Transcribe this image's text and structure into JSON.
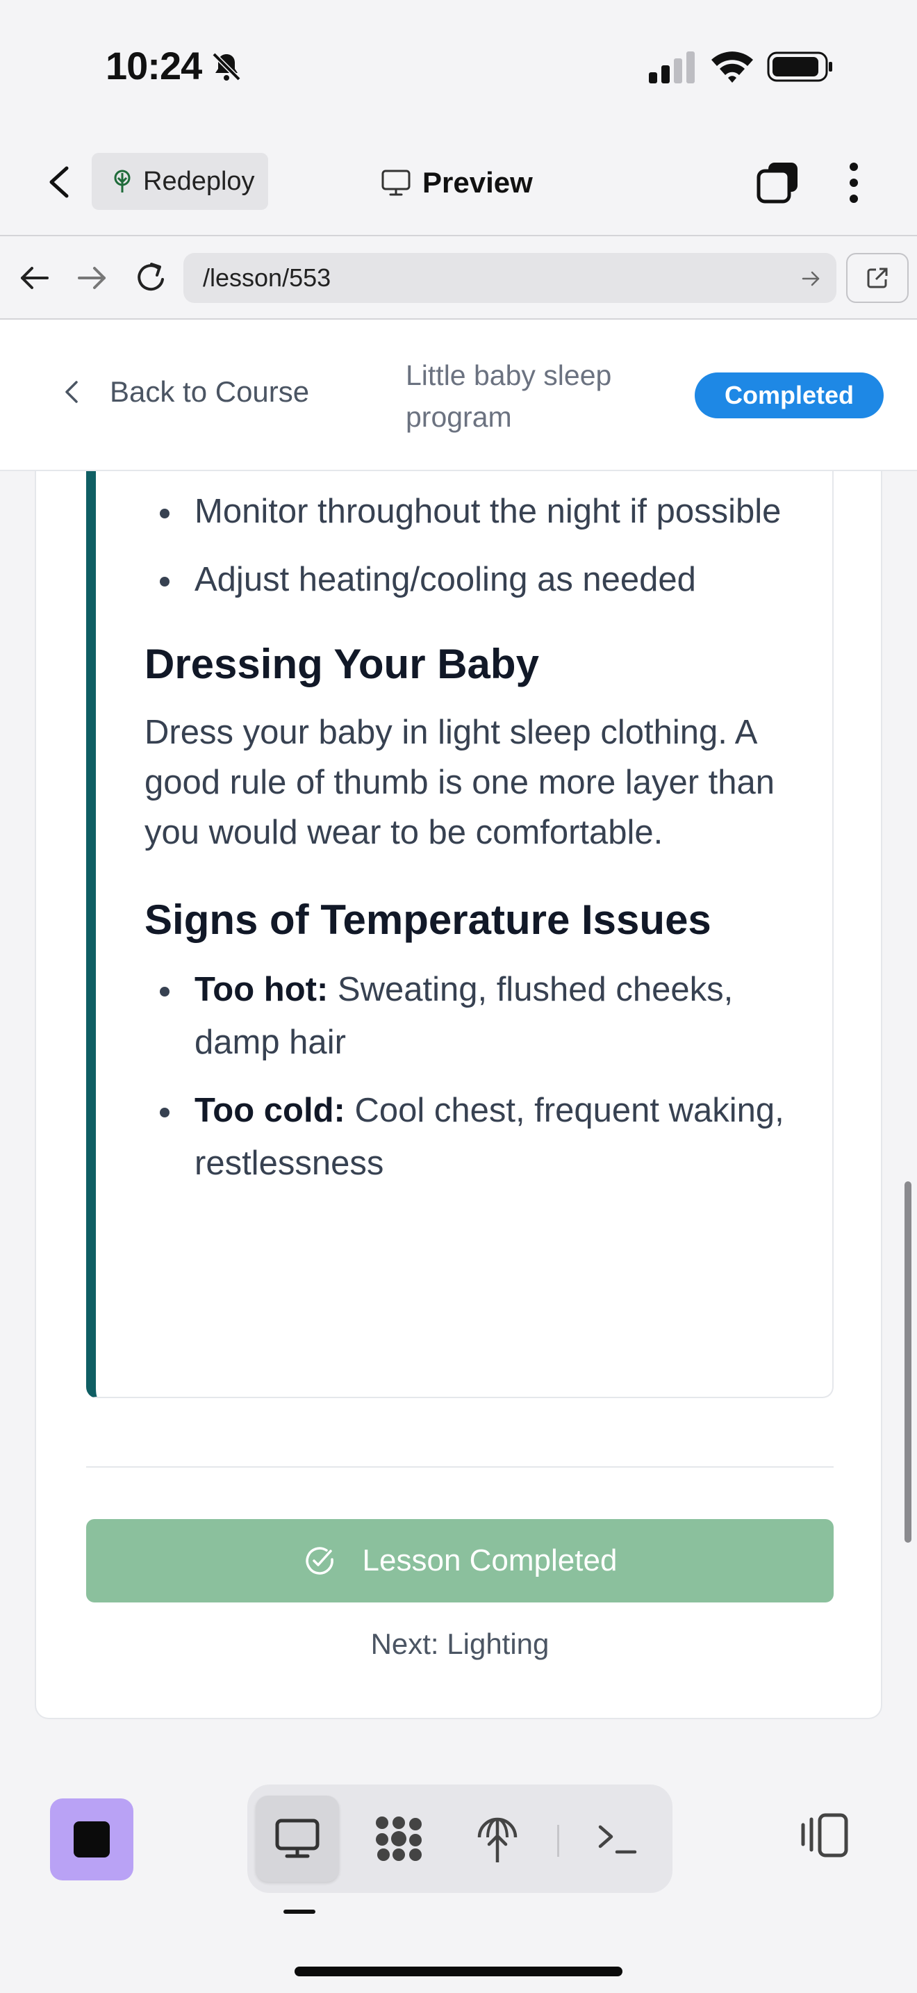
{
  "status_bar": {
    "time": "10:24"
  },
  "app_bar": {
    "redeploy_label": "Redeploy",
    "preview_label": "Preview"
  },
  "browser": {
    "url": "/lesson/553"
  },
  "page_header": {
    "back_label": "Back to Course",
    "course_title": "Little baby sleep program",
    "status_badge": "Completed"
  },
  "lesson": {
    "top_bullets": [
      "Monitor throughout the night if possible",
      "Adjust heating/cooling as needed"
    ],
    "dressing": {
      "heading": "Dressing Your Baby",
      "text": "Dress your baby in light sleep clothing. A good rule of thumb is one more layer than you would wear to be comfortable."
    },
    "signs": {
      "heading": "Signs of Temperature Issues",
      "items": [
        {
          "label": "Too hot:",
          "text": " Sweating, flushed cheeks, damp hair"
        },
        {
          "label": "Too cold:",
          "text": " Cool chest, frequent waking, restlessness"
        }
      ]
    }
  },
  "footer": {
    "completed_button": "Lesson Completed",
    "next_lesson": "Next: Lighting"
  },
  "colors": {
    "accent_border": "#0f5e63",
    "badge_blue": "#1e88e5",
    "completed_green": "#8bc09d",
    "stop_purple": "#b9a2f5"
  },
  "icons": {
    "toolbar": [
      "desktop-icon",
      "apps-icon",
      "deploy-icon",
      "terminal-icon"
    ]
  }
}
